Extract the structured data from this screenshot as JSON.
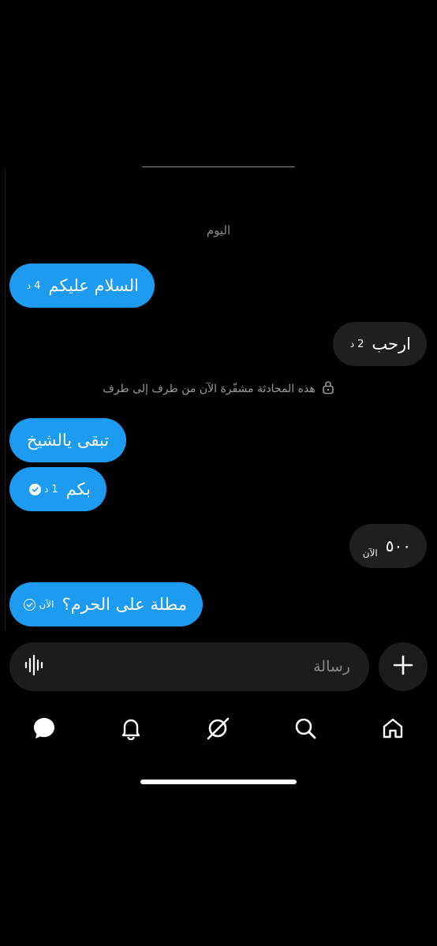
{
  "chat": {
    "day_label": "اليوم",
    "encryption_notice": "هذه المحادثة مشفّرة الآن من طرف إلى طرف",
    "messages": [
      {
        "side": "sent",
        "text": "السلام عليكم",
        "time_num": "4",
        "time_unit": "د",
        "status": "none"
      },
      {
        "side": "received",
        "text": "ارحب",
        "time_num": "2",
        "time_unit": "د"
      },
      {
        "side": "sent",
        "text": "تبقى يالشيخ",
        "time_num": "",
        "time_unit": "",
        "status": "none"
      },
      {
        "side": "sent",
        "text": "بكم",
        "time_num": "1",
        "time_unit": "د",
        "status": "read"
      },
      {
        "side": "received",
        "text": "٥٠٠",
        "time_num": "",
        "time_unit": "الآن"
      },
      {
        "side": "sent",
        "text": "مطلة على الحرم؟",
        "time_num": "",
        "time_unit": "الآن",
        "status": "sent"
      }
    ]
  },
  "composer": {
    "placeholder": "رسالة",
    "voice_icon": "voice-waveform-icon",
    "add_icon": "plus-icon"
  },
  "nav": {
    "items": [
      "messages-icon",
      "notifications-icon",
      "grok-icon",
      "search-icon",
      "home-icon"
    ],
    "active": "messages-icon"
  },
  "colors": {
    "sent_bubble": "#1d9bf0",
    "received_bubble": "#1f1f1f",
    "background": "#000000"
  }
}
